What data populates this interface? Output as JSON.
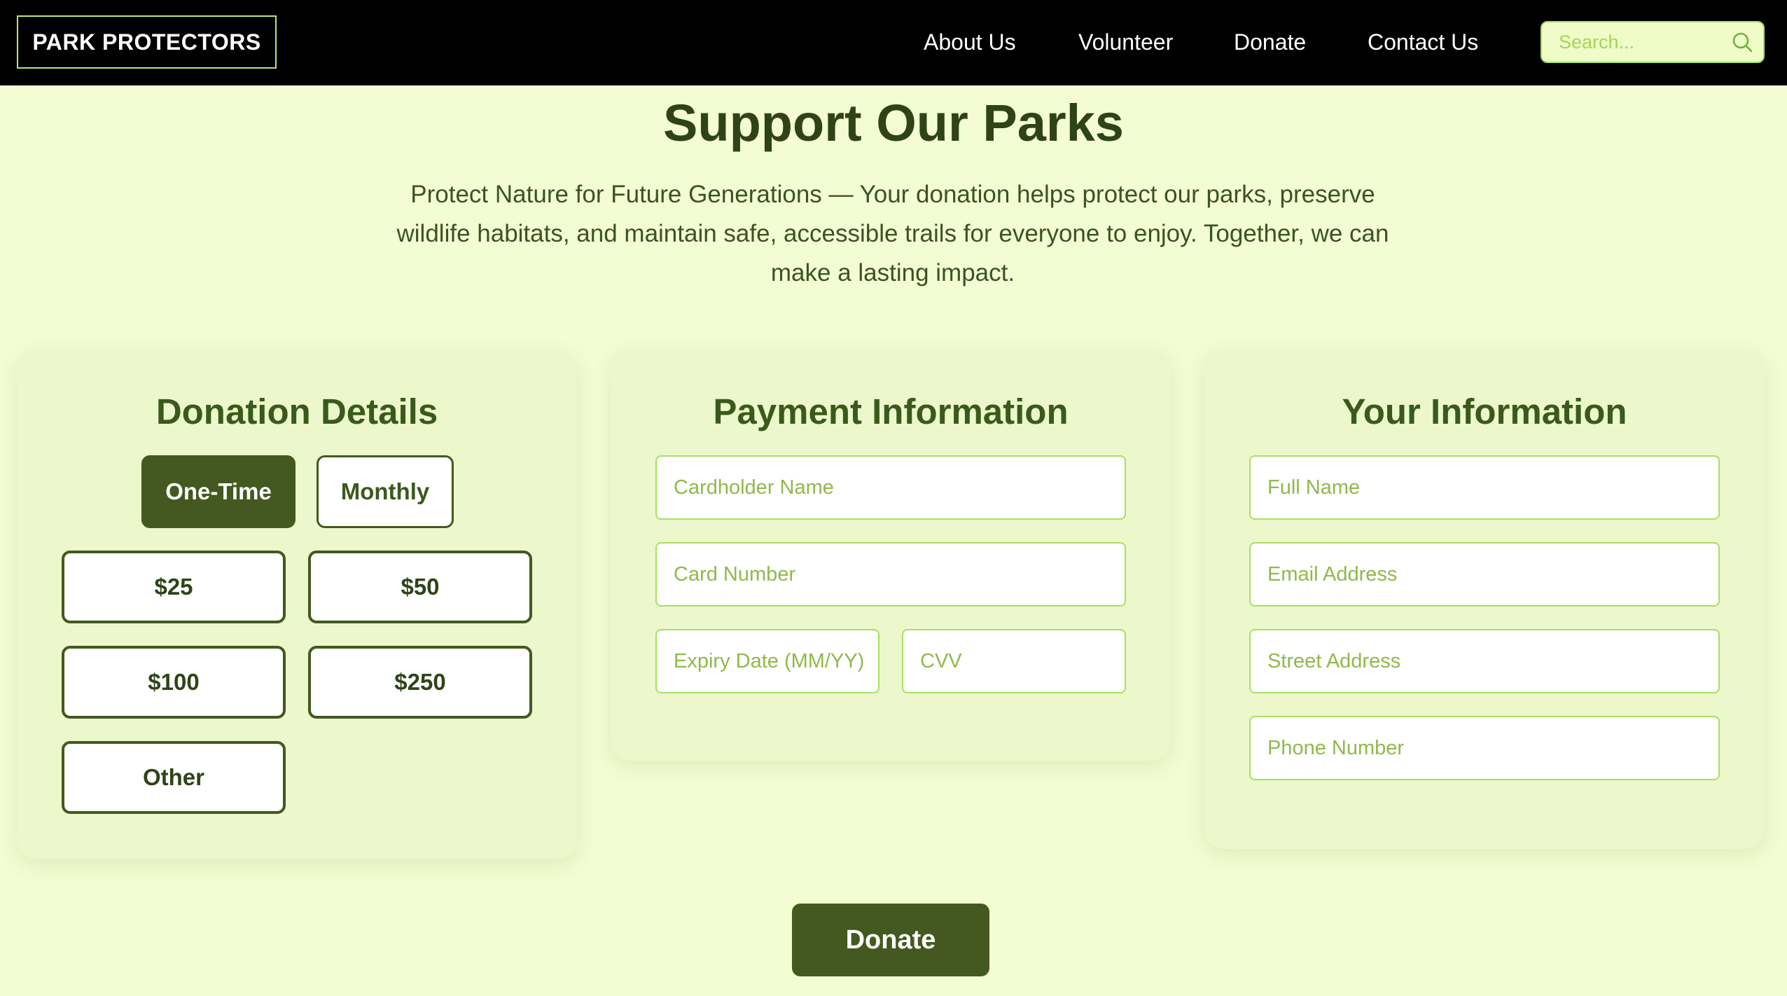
{
  "nav": {
    "logo": "PARK PROTECTORS",
    "links": [
      {
        "label": "About Us"
      },
      {
        "label": "Volunteer"
      },
      {
        "label": "Donate"
      },
      {
        "label": "Contact Us"
      }
    ],
    "search_placeholder": "Search...",
    "search_icon": "search-icon"
  },
  "hero": {
    "title": "Support Our Parks",
    "intro": "Protect Nature for Future Generations — Your donation helps protect our parks, preserve wildlife habitats, and maintain safe, accessible trails for everyone to enjoy. Together, we can make a lasting impact."
  },
  "donation_details": {
    "title": "Donation Details",
    "frequency_options": [
      {
        "label": "One-Time",
        "selected": true
      },
      {
        "label": "Monthly",
        "selected": false
      }
    ],
    "amounts": [
      {
        "label": "$25"
      },
      {
        "label": "$50"
      },
      {
        "label": "$100"
      },
      {
        "label": "$250"
      },
      {
        "label": "Other"
      }
    ]
  },
  "payment": {
    "title": "Payment Information",
    "fields": {
      "cardholder": "Cardholder Name",
      "card_number": "Card Number",
      "expiry": "Expiry Date (MM/YY)",
      "cvv": "CVV"
    }
  },
  "your_info": {
    "title": "Your Information",
    "fields": {
      "full_name": "Full Name",
      "email": "Email Address",
      "street": "Street Address",
      "phone": "Phone Number"
    }
  },
  "submit": {
    "label": "Donate"
  },
  "colors": {
    "page_bg": "#f4fcd2",
    "nav_bg": "#000000",
    "card_bg": "#ecf8cc",
    "primary": "#43591f",
    "accent": "#a7e060",
    "heading": "#2e4417"
  }
}
